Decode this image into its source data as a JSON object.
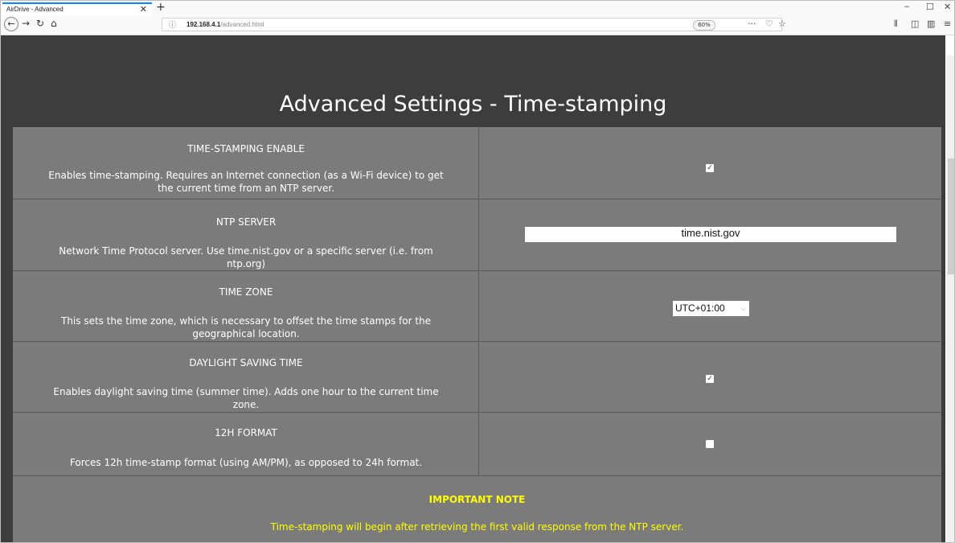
{
  "browser": {
    "tab_title": "AirDrive - Advanced",
    "tab_close": "✕",
    "new_tab": "+",
    "url_host": "192.168.4.1",
    "url_path": "/advanced.html",
    "zoom": "60%",
    "window_controls": [
      "–",
      "☐",
      "✕"
    ],
    "icons": {
      "back": "back-arrow-icon",
      "forward": "forward-arrow-icon",
      "reload": "reload-icon",
      "home": "home-icon",
      "info": "info-icon",
      "page_actions": "more-icon",
      "pocket": "pocket-icon",
      "bookmark": "star-icon",
      "library": "library-icon",
      "sidebar": "sidebar-icon",
      "reader": "reader-icon",
      "menu": "hamburger-menu-icon"
    }
  },
  "page": {
    "title": "Advanced Settings - Time-stamping",
    "rows": [
      {
        "title": "TIME-STAMPING ENABLE",
        "desc_line1": "Enables time-stamping. Requires an Internet connection (as a Wi-Fi device) to get",
        "desc_line2": "the current time from an NTP server.",
        "control": "checkbox",
        "checked": true
      },
      {
        "title": "NTP SERVER",
        "desc_line1": "Network Time Protocol server. Use time.nist.gov or a specific server (i.e. from",
        "desc_line2": "ntp.org)",
        "control": "text",
        "value": "time.nist.gov"
      },
      {
        "title": "TIME ZONE",
        "desc_line1": "This sets the time zone, which is necessary to offset the time stamps for the",
        "desc_line2": "geographical location.",
        "control": "select",
        "value": "UTC+01:00"
      },
      {
        "title": "DAYLIGHT SAVING TIME",
        "desc_line1": "Enables daylight saving time (summer time). Adds one hour to the current time",
        "desc_line2": "zone.",
        "control": "checkbox",
        "checked": true
      },
      {
        "title": "12H FORMAT",
        "desc_line1": "Forces 12h time-stamp format (using AM/PM), as opposed to 24h format.",
        "desc_line2": "",
        "control": "checkbox",
        "checked": false
      }
    ],
    "note_title": "IMPORTANT NOTE",
    "note_text": "Time-stamping will begin after retrieving the first valid response from the NTP server."
  },
  "colors": {
    "page_bg": "#3d3d3d",
    "row_bg": "#7b7b7b",
    "note_text": "#ffff00",
    "tab_accent": "#0a84ff"
  }
}
